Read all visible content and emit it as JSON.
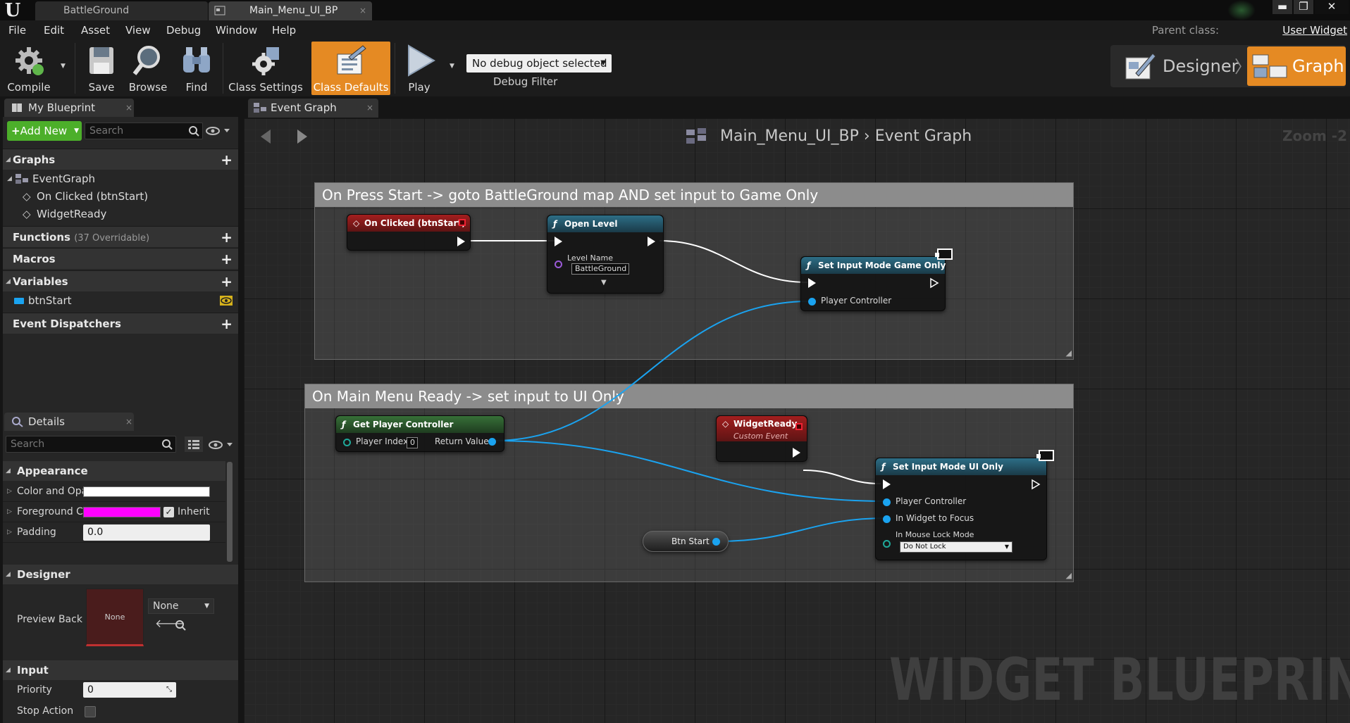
{
  "titlebar": {
    "tabs": [
      {
        "label": "BattleGround"
      },
      {
        "label": "Main_Menu_UI_BP"
      }
    ],
    "close_glyph": "×",
    "window_buttons": [
      "▬",
      "❐",
      "✕"
    ]
  },
  "menubar": {
    "items": [
      "File",
      "Edit",
      "Asset",
      "View",
      "Debug",
      "Window",
      "Help"
    ],
    "parent_class_label": "Parent class:",
    "parent_class_value": "User Widget"
  },
  "toolbar": {
    "compile": "Compile",
    "save": "Save",
    "browse": "Browse",
    "find": "Find",
    "class_settings": "Class Settings",
    "class_defaults": "Class Defaults",
    "play": "Play",
    "debug_object": "No debug object selected",
    "debug_filter": "Debug Filter",
    "mode_designer": "Designer",
    "mode_graph": "Graph",
    "mode_separator": "〉",
    "accent": "#e58a23"
  },
  "my_blueprint": {
    "tab": "My Blueprint",
    "add_new": "Add New",
    "search_placeholder": "Search",
    "graphs_label": "Graphs",
    "graph_items": [
      "EventGraph",
      "On Clicked (btnStart)",
      "WidgetReady"
    ],
    "functions_label": "Functions",
    "functions_count": "(37 Overridable)",
    "macros_label": "Macros",
    "variables_label": "Variables",
    "variable_items": [
      "btnStart"
    ],
    "dispatchers_label": "Event Dispatchers"
  },
  "details": {
    "tab": "Details",
    "search_placeholder": "Search",
    "appearance_label": "Appearance",
    "color_label": "Color and Opa",
    "foreground_label": "Foreground C",
    "foreground_color": "#ff00ff",
    "inherit_label": "Inherit",
    "padding_label": "Padding",
    "padding_value": "0.0",
    "designer_label": "Designer",
    "preview_label": "Preview Back",
    "preview_value": "None",
    "preview_dropdown": "None",
    "input_label": "Input",
    "priority_label": "Priority",
    "priority_value": "0",
    "stop_action_label": "Stop Action"
  },
  "graph": {
    "tab": "Event Graph",
    "breadcrumb_bp": "Main_Menu_UI_BP",
    "breadcrumb_sep": "›",
    "breadcrumb_graph": "Event Graph",
    "zoom": "Zoom -2",
    "watermark": "WIDGET BLUEPRINT",
    "comment1": "On Press Start -> goto BattleGround map AND set input to Game Only",
    "comment2": "On Main Menu Ready -> set input to UI Only",
    "nodes": {
      "on_clicked": "On Clicked (btnStart)",
      "open_level": "Open Level",
      "level_name_label": "Level Name",
      "level_name_value": "BattleGround",
      "set_game_only": "Set Input Mode Game Only",
      "player_controller": "Player Controller",
      "get_player_controller": "Get Player Controller",
      "player_index_label": "Player Index",
      "player_index_value": "0",
      "return_value": "Return Value",
      "widget_ready": "WidgetReady",
      "custom_event": "Custom Event",
      "set_ui_only": "Set Input Mode UI Only",
      "player_controller_2": "Player Controller",
      "in_widget_focus": "In Widget to Focus",
      "in_mouse_lock": "In Mouse Lock Mode",
      "mouse_lock_value": "Do Not Lock",
      "btn_start": "Btn Start"
    }
  }
}
